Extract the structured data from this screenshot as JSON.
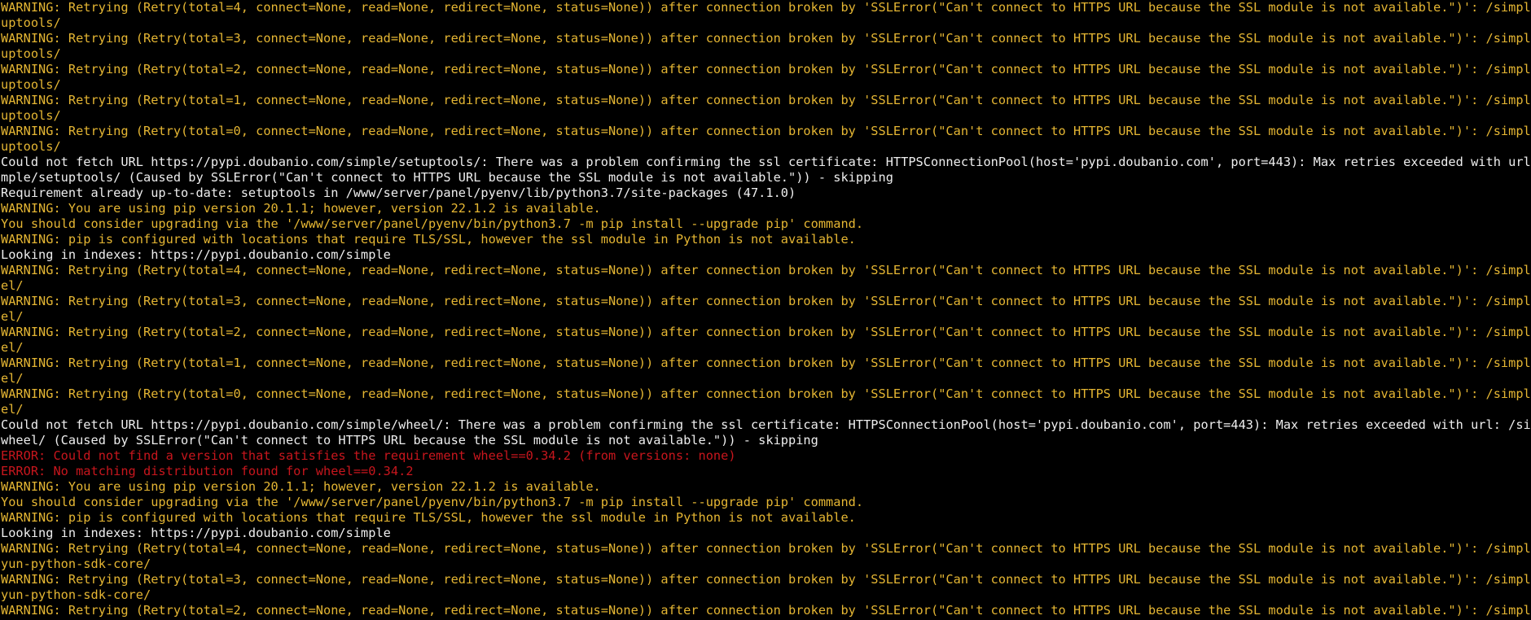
{
  "terminal": {
    "colors": {
      "background": "#000000",
      "warning": "#e5b633",
      "normal": "#eeeeee",
      "error": "#c8161d"
    },
    "lines": [
      {
        "kind": "warn",
        "text": "WARNING: Retrying (Retry(total=4, connect=None, read=None, redirect=None, status=None)) after connection broken by 'SSLError(\"Can't connect to HTTPS URL because the SSL module is not available.\")': /simple/set"
      },
      {
        "kind": "warn",
        "text": "uptools/"
      },
      {
        "kind": "warn",
        "text": "WARNING: Retrying (Retry(total=3, connect=None, read=None, redirect=None, status=None)) after connection broken by 'SSLError(\"Can't connect to HTTPS URL because the SSL module is not available.\")': /simple/set"
      },
      {
        "kind": "warn",
        "text": "uptools/"
      },
      {
        "kind": "warn",
        "text": "WARNING: Retrying (Retry(total=2, connect=None, read=None, redirect=None, status=None)) after connection broken by 'SSLError(\"Can't connect to HTTPS URL because the SSL module is not available.\")': /simple/set"
      },
      {
        "kind": "warn",
        "text": "uptools/"
      },
      {
        "kind": "warn",
        "text": "WARNING: Retrying (Retry(total=1, connect=None, read=None, redirect=None, status=None)) after connection broken by 'SSLError(\"Can't connect to HTTPS URL because the SSL module is not available.\")': /simple/set"
      },
      {
        "kind": "warn",
        "text": "uptools/"
      },
      {
        "kind": "warn",
        "text": "WARNING: Retrying (Retry(total=0, connect=None, read=None, redirect=None, status=None)) after connection broken by 'SSLError(\"Can't connect to HTTPS URL because the SSL module is not available.\")': /simple/set"
      },
      {
        "kind": "warn",
        "text": "uptools/"
      },
      {
        "kind": "plain",
        "text": "Could not fetch URL https://pypi.doubanio.com/simple/setuptools/: There was a problem confirming the ssl certificate: HTTPSConnectionPool(host='pypi.doubanio.com', port=443): Max retries exceeded with url: /si"
      },
      {
        "kind": "plain",
        "text": "mple/setuptools/ (Caused by SSLError(\"Can't connect to HTTPS URL because the SSL module is not available.\")) - skipping"
      },
      {
        "kind": "plain",
        "text": "Requirement already up-to-date: setuptools in /www/server/panel/pyenv/lib/python3.7/site-packages (47.1.0)"
      },
      {
        "kind": "warn",
        "text": "WARNING: You are using pip version 20.1.1; however, version 22.1.2 is available."
      },
      {
        "kind": "warn",
        "text": "You should consider upgrading via the '/www/server/panel/pyenv/bin/python3.7 -m pip install --upgrade pip' command."
      },
      {
        "kind": "warn",
        "text": "WARNING: pip is configured with locations that require TLS/SSL, however the ssl module in Python is not available."
      },
      {
        "kind": "plain",
        "text": "Looking in indexes: https://pypi.doubanio.com/simple"
      },
      {
        "kind": "warn",
        "text": "WARNING: Retrying (Retry(total=4, connect=None, read=None, redirect=None, status=None)) after connection broken by 'SSLError(\"Can't connect to HTTPS URL because the SSL module is not available.\")': /simple/whe"
      },
      {
        "kind": "warn",
        "text": "el/"
      },
      {
        "kind": "warn",
        "text": "WARNING: Retrying (Retry(total=3, connect=None, read=None, redirect=None, status=None)) after connection broken by 'SSLError(\"Can't connect to HTTPS URL because the SSL module is not available.\")': /simple/whe"
      },
      {
        "kind": "warn",
        "text": "el/"
      },
      {
        "kind": "warn",
        "text": "WARNING: Retrying (Retry(total=2, connect=None, read=None, redirect=None, status=None)) after connection broken by 'SSLError(\"Can't connect to HTTPS URL because the SSL module is not available.\")': /simple/whe"
      },
      {
        "kind": "warn",
        "text": "el/"
      },
      {
        "kind": "warn",
        "text": "WARNING: Retrying (Retry(total=1, connect=None, read=None, redirect=None, status=None)) after connection broken by 'SSLError(\"Can't connect to HTTPS URL because the SSL module is not available.\")': /simple/whe"
      },
      {
        "kind": "warn",
        "text": "el/"
      },
      {
        "kind": "warn",
        "text": "WARNING: Retrying (Retry(total=0, connect=None, read=None, redirect=None, status=None)) after connection broken by 'SSLError(\"Can't connect to HTTPS URL because the SSL module is not available.\")': /simple/whe"
      },
      {
        "kind": "warn",
        "text": "el/"
      },
      {
        "kind": "plain",
        "text": "Could not fetch URL https://pypi.doubanio.com/simple/wheel/: There was a problem confirming the ssl certificate: HTTPSConnectionPool(host='pypi.doubanio.com', port=443): Max retries exceeded with url: /simple/"
      },
      {
        "kind": "plain",
        "text": "wheel/ (Caused by SSLError(\"Can't connect to HTTPS URL because the SSL module is not available.\")) - skipping"
      },
      {
        "kind": "err",
        "text": "ERROR: Could not find a version that satisfies the requirement wheel==0.34.2 (from versions: none)"
      },
      {
        "kind": "err",
        "text": "ERROR: No matching distribution found for wheel==0.34.2"
      },
      {
        "kind": "warn",
        "text": "WARNING: You are using pip version 20.1.1; however, version 22.1.2 is available."
      },
      {
        "kind": "warn",
        "text": "You should consider upgrading via the '/www/server/panel/pyenv/bin/python3.7 -m pip install --upgrade pip' command."
      },
      {
        "kind": "warn",
        "text": "WARNING: pip is configured with locations that require TLS/SSL, however the ssl module in Python is not available."
      },
      {
        "kind": "plain",
        "text": "Looking in indexes: https://pypi.doubanio.com/simple"
      },
      {
        "kind": "warn",
        "text": "WARNING: Retrying (Retry(total=4, connect=None, read=None, redirect=None, status=None)) after connection broken by 'SSLError(\"Can't connect to HTTPS URL because the SSL module is not available.\")': /simple/ali"
      },
      {
        "kind": "warn",
        "text": "yun-python-sdk-core/"
      },
      {
        "kind": "warn",
        "text": "WARNING: Retrying (Retry(total=3, connect=None, read=None, redirect=None, status=None)) after connection broken by 'SSLError(\"Can't connect to HTTPS URL because the SSL module is not available.\")': /simple/ali"
      },
      {
        "kind": "warn",
        "text": "yun-python-sdk-core/"
      },
      {
        "kind": "warn",
        "text": "WARNING: Retrying (Retry(total=2, connect=None, read=None, redirect=None, status=None)) after connection broken by 'SSLError(\"Can't connect to HTTPS URL because the SSL module is not available.\")': /simple/ali"
      }
    ]
  }
}
